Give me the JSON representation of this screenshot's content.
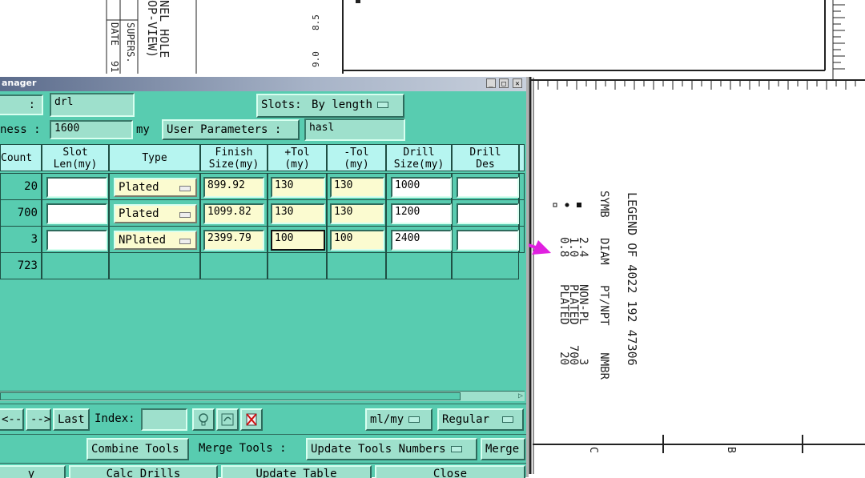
{
  "window": {
    "title": "anager"
  },
  "form": {
    "row1_label": ":",
    "row1_value": "drl",
    "slots_label": "Slots:",
    "slots_value": "By length",
    "row2_label": "ness :",
    "row2_value": "1600",
    "row2_unit": "my",
    "user_params_label": "User Parameters :",
    "user_params_value": "hasl"
  },
  "table": {
    "headers": [
      "Count",
      "Slot\nLen(my)",
      "Type",
      "Finish\nSize(my)",
      "+Tol\n(my)",
      "-Tol\n(my)",
      "Drill\nSize(my)",
      "Drill\nDes"
    ],
    "rows": [
      {
        "count": "20",
        "slot_len": "",
        "type": "Plated",
        "finish": "899.92",
        "ptol": "130",
        "ntol": "130",
        "drill": "1000",
        "des": ""
      },
      {
        "count": "700",
        "slot_len": "",
        "type": "Plated",
        "finish": "1099.82",
        "ptol": "130",
        "ntol": "130",
        "drill": "1200",
        "des": ""
      },
      {
        "count": "3",
        "slot_len": "",
        "type": "NPlated",
        "finish": "2399.79",
        "ptol": "100",
        "ntol": "100",
        "drill": "2400",
        "des": ""
      }
    ],
    "total": "723"
  },
  "toolbar1": {
    "prev": "<--",
    "next": "-->",
    "last": "Last",
    "index_label": "Index:",
    "index_value": "",
    "units": "ml/my",
    "mode": "Regular"
  },
  "toolbar2": {
    "combine": "Combine Tools",
    "merge_label": "Merge Tools :",
    "update_numbers": "Update Tools Numbers",
    "merge": "Merge"
  },
  "toolbar3": {
    "btn1": "y",
    "calc": "Calc Drills",
    "update_table": "Update Table",
    "close": "Close"
  },
  "drawing": {
    "top_text_1": "NEL HOLE",
    "top_text_2": "OP-VIEW)",
    "supers": "SUPERS.",
    "date": "DATE",
    "date_val": "91",
    "ruler_a": "8.5",
    "ruler_b": "9.0",
    "legend_title": "LEGEND OF 4022 192 47306",
    "legend_cols": "SYMB   DIAM   PT/NPT    NMBR",
    "legend_r1": "2.4    NON-PL     3",
    "legend_r2": "1.0    PLATED   700",
    "legend_r3": "0.8    PLATED    20",
    "grid_c": "C",
    "grid_b": "B",
    "arrow_color": "#e020e0"
  }
}
